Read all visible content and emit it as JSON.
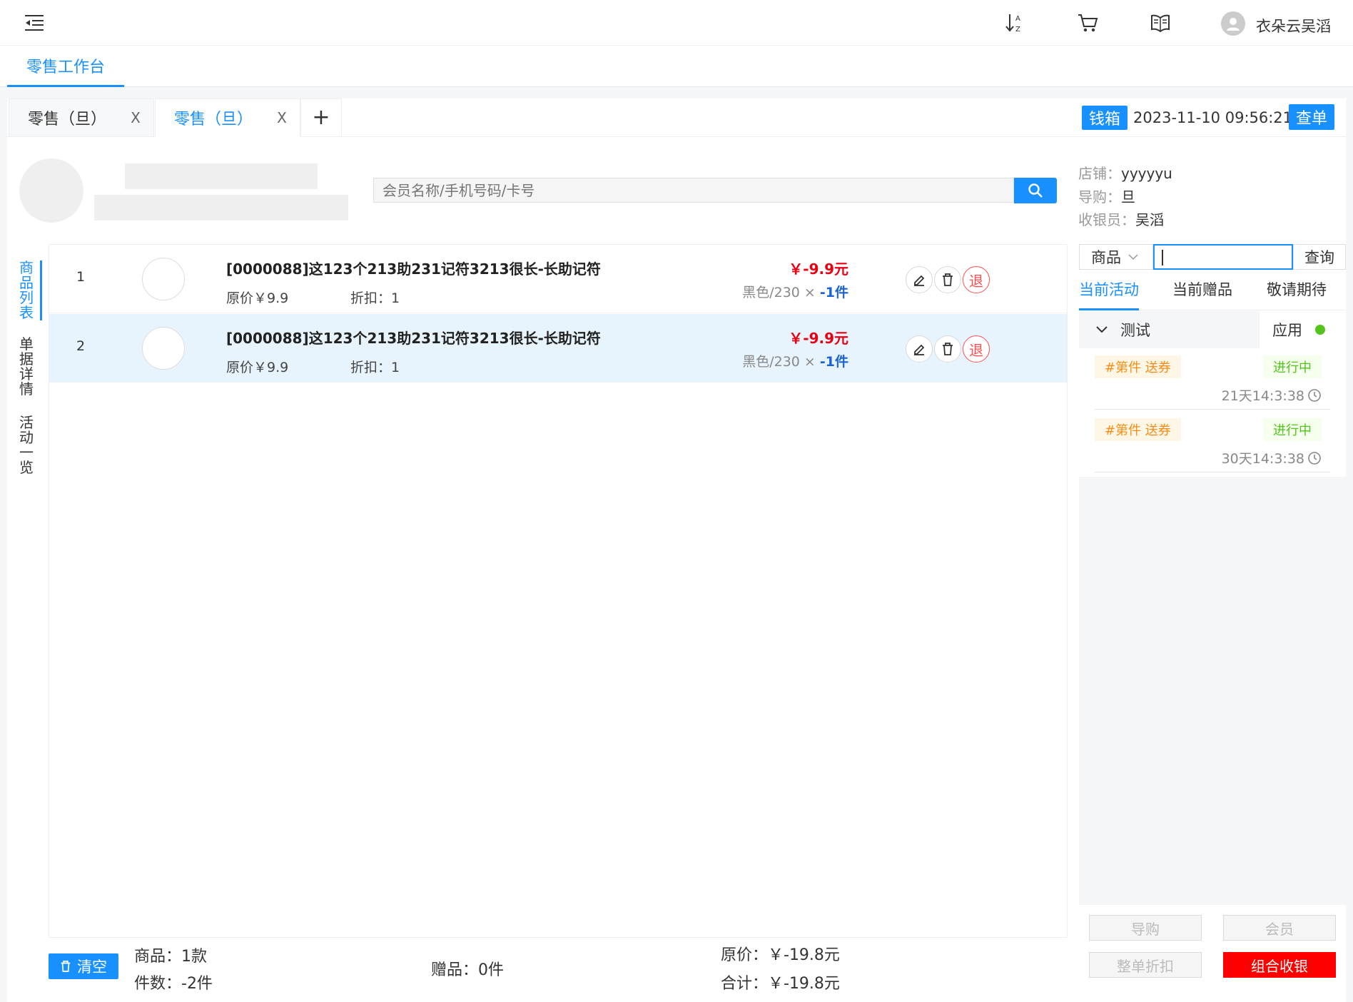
{
  "topbar": {
    "user_name": "衣朵云吴滔",
    "icons": [
      "menu-fold-icon",
      "sort-az-icon",
      "cart-icon",
      "book-icon",
      "user-avatar-icon"
    ]
  },
  "nav": {
    "workbench_tab": "零售工作台"
  },
  "doc_tabs": [
    {
      "label": "零售（旦）",
      "close": "X",
      "active": false
    },
    {
      "label": "零售（旦）",
      "close": "X",
      "active": true
    }
  ],
  "tab_add": "+",
  "header": {
    "cashbox_label": "钱箱",
    "datetime": "2023-11-10 09:56:21",
    "query_order_label": "查单"
  },
  "member": {
    "search_placeholder": "会员名称/手机号码/卡号"
  },
  "store_info": {
    "store_label": "店铺：",
    "store_value": "yyyyyu",
    "guide_label": "导购：",
    "guide_value": "旦",
    "cashier_label": "收银员：",
    "cashier_value": "吴滔"
  },
  "side_tabs": [
    "商品列表",
    "单据详情",
    "活动一览"
  ],
  "items": [
    {
      "index": "1",
      "title": "[0000088]这123个213助231记符3213很长-长助记符",
      "orig_price": "原价￥9.9",
      "discount": "折扣：1",
      "price": "￥-9.9元",
      "spec": "黑色/230 ×",
      "qty": "-1件",
      "return_label": "退",
      "selected": false
    },
    {
      "index": "2",
      "title": "[0000088]这123个213助231记符3213很长-长助记符",
      "orig_price": "原价￥9.9",
      "discount": "折扣：1",
      "price": "￥-9.9元",
      "spec": "黑色/230 ×",
      "qty": "-1件",
      "return_label": "退",
      "selected": true
    }
  ],
  "footer": {
    "clear_label": "清空",
    "goods_count": "商品：1款",
    "piece_count": "件数：-2件",
    "gift_count": "赠品：0件",
    "original_total": "原价：￥-19.8元",
    "total": "合计：￥-19.8元"
  },
  "right_panel": {
    "select_value": "商品",
    "query_label": "查询",
    "tabs": [
      "当前活动",
      "当前赠品",
      "敬请期待"
    ],
    "activity_name": "测试",
    "apply_label": "应用",
    "activities": [
      {
        "tag": "#第件 送券",
        "status": "进行中",
        "time": "21天14:3:38"
      },
      {
        "tag": "#第件 送券",
        "status": "进行中",
        "time": "30天14:3:38"
      }
    ],
    "buttons": {
      "guide": "导购",
      "member": "会员",
      "whole_discount": "整单折扣",
      "combined_checkout": "组合收银"
    }
  },
  "colors": {
    "primary": "#1890ff",
    "danger": "#e60012",
    "success": "#52c41a",
    "warning": "#fa8c16",
    "checkout": "#ff0000"
  }
}
